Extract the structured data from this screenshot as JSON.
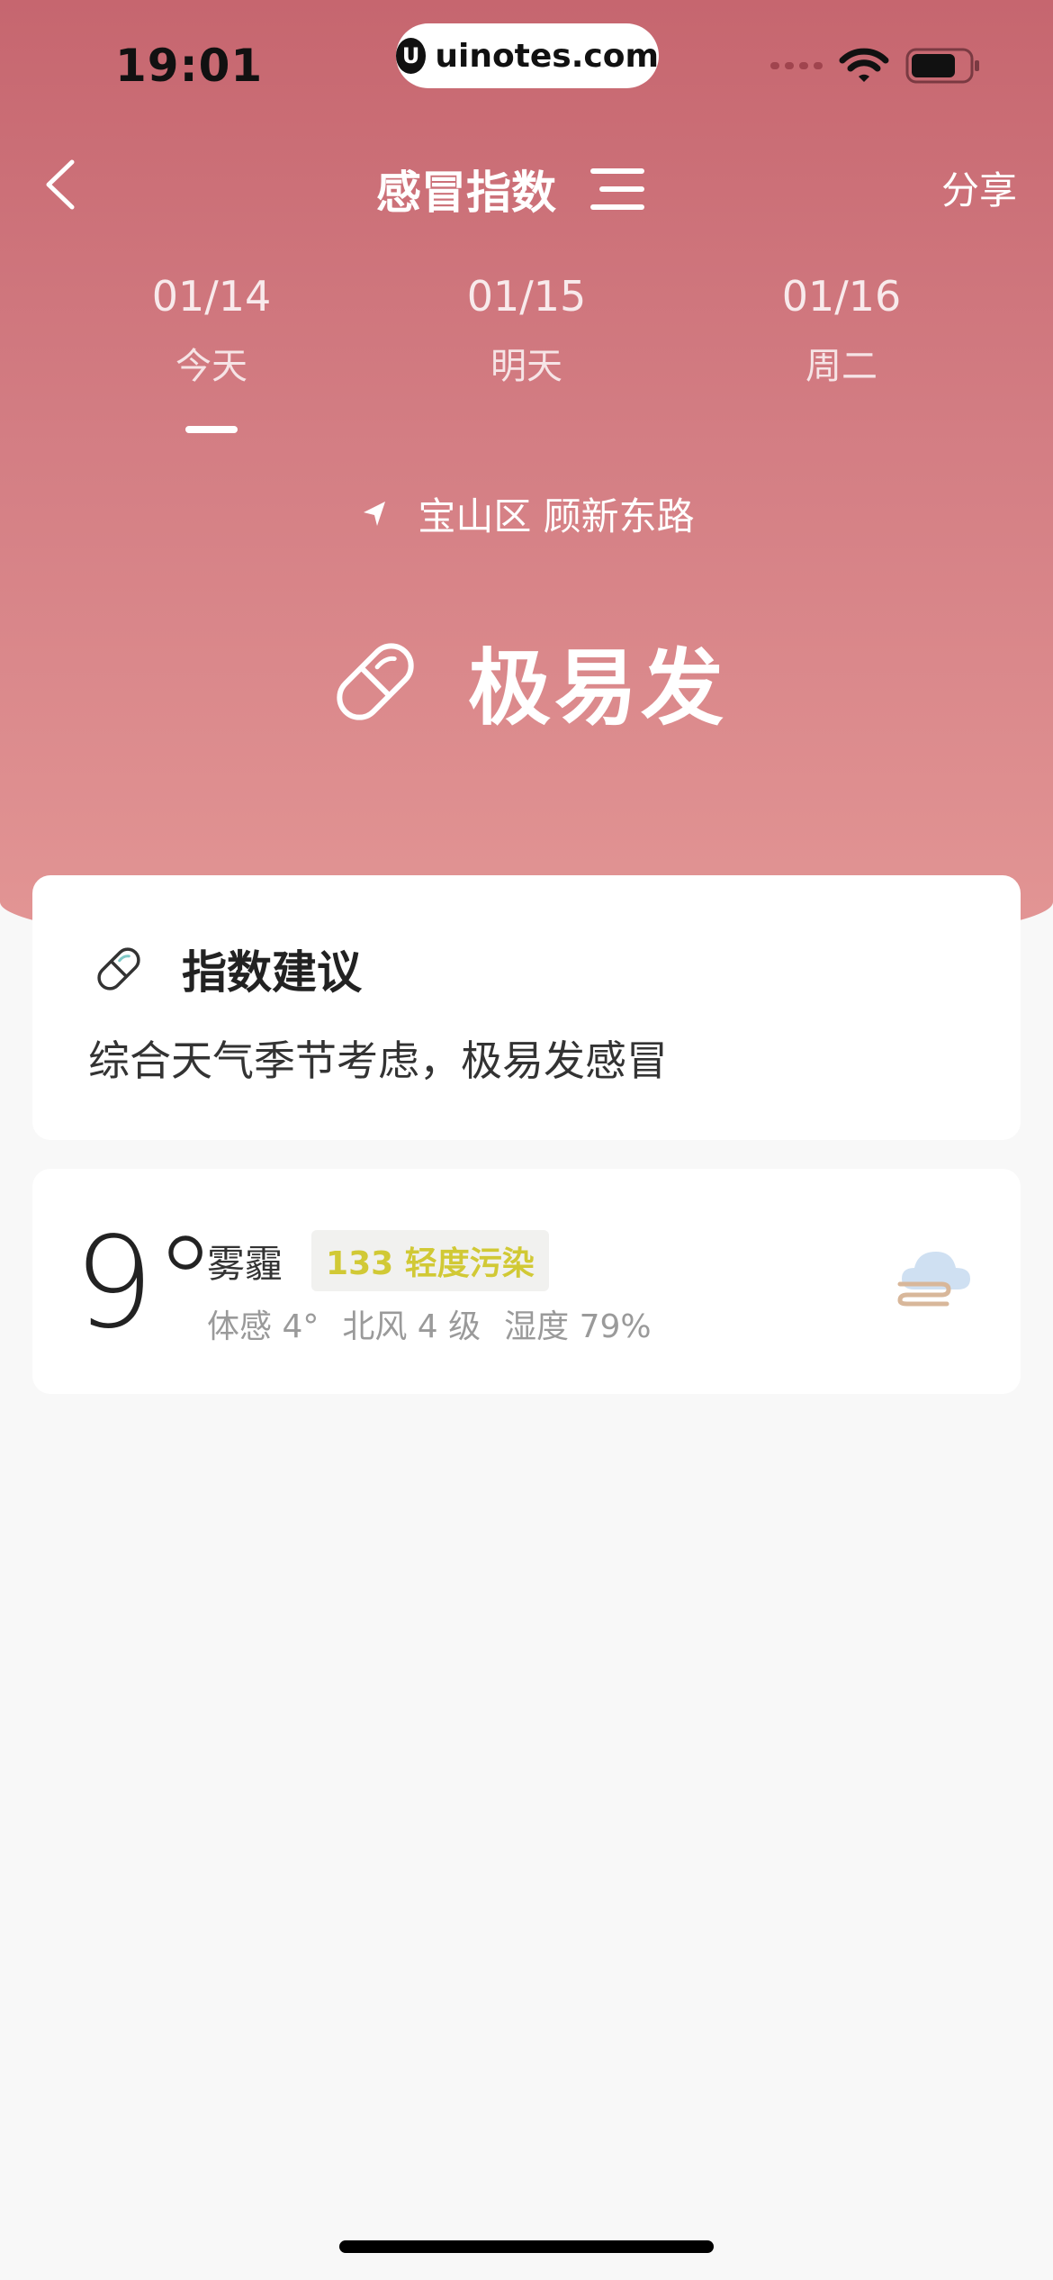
{
  "status_bar": {
    "time": "19:01",
    "url": "uinotes.com"
  },
  "nav": {
    "title": "感冒指数",
    "share_label": "分享"
  },
  "date_tabs": [
    {
      "date": "01/14",
      "label": "今天",
      "selected": true
    },
    {
      "date": "01/15",
      "label": "明天",
      "selected": false
    },
    {
      "date": "01/16",
      "label": "周二",
      "selected": false
    }
  ],
  "location": {
    "text": "宝山区 顾新东路"
  },
  "index_status": {
    "level": "极易发"
  },
  "advice": {
    "title": "指数建议",
    "text": "综合天气季节考虑，极易发感冒"
  },
  "weather": {
    "temperature": "9°",
    "condition": "雾霾",
    "aqi": "133 轻度污染",
    "feels_like": "体感 4°",
    "wind": "北风 4 级",
    "humidity": "湿度 79%"
  },
  "colors": {
    "header_top": "#c6666f",
    "header_bottom": "#e39695",
    "aqi_text": "#d1c935",
    "background": "#f8f8f8"
  }
}
